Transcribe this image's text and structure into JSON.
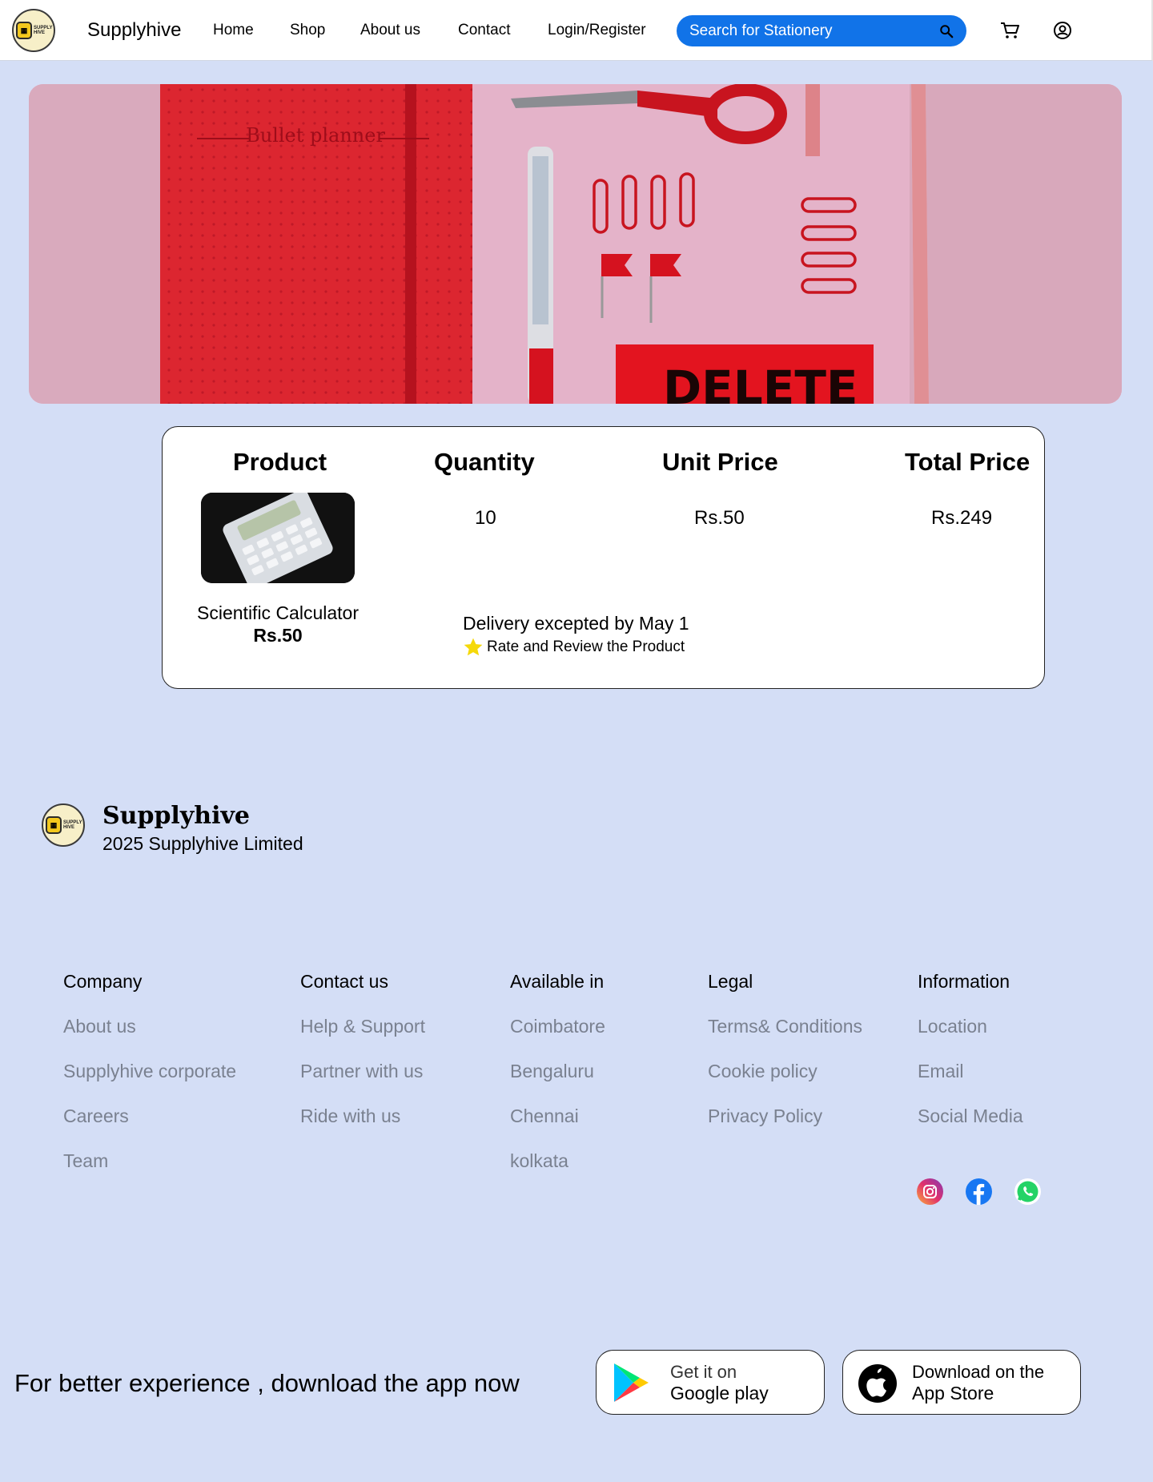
{
  "nav": {
    "brand": "Supplyhive",
    "logo_text": "SUPPLY HIVE",
    "links": [
      "Home",
      "Shop",
      "About us",
      "Contact",
      "Login/Register"
    ],
    "search_placeholder": "Search for Stationery",
    "search_icon": "search-icon",
    "cart_icon": "cart-icon",
    "account_icon": "account-icon"
  },
  "hero": {
    "notebook_label": "Bullet planner",
    "eraser_label": "DELETE"
  },
  "order": {
    "headers": [
      "Product",
      "Quantity",
      "Unit Price",
      "Total Price"
    ],
    "quantity": "10",
    "unit_price": "Rs.50",
    "total_price": "Rs.249",
    "product_name": "Scientific Calculator",
    "product_price": "Rs.50",
    "delivery": "Delivery excepted by May 1",
    "rate_label": "Rate and Review the Product",
    "star_color": "#f5d90a"
  },
  "footer": {
    "brand": "Supplyhive",
    "copyright": "2025 Supplyhive Limited",
    "columns": [
      {
        "title": "Company",
        "items": [
          "About us",
          "Supplyhive corporate",
          "Careers",
          "Team"
        ]
      },
      {
        "title": "Contact us",
        "items": [
          "Help & Support",
          "Partner with us",
          "Ride with us"
        ]
      },
      {
        "title": "Available in",
        "items": [
          "Coimbatore",
          "Bengaluru",
          "Chennai",
          "kolkata"
        ]
      },
      {
        "title": "Legal",
        "items": [
          "Terms& Conditions",
          "Cookie policy",
          "Privacy Policy"
        ]
      },
      {
        "title": "Information",
        "items": [
          "Location",
          "Email",
          "Social Media"
        ]
      }
    ],
    "socials": [
      "instagram-icon",
      "facebook-icon",
      "whatsapp-icon"
    ]
  },
  "app": {
    "cta": "For better experience , download the app now",
    "google": {
      "line1": "Get it on",
      "line2": "Google play"
    },
    "apple": {
      "line1": "Download on the",
      "line2": "App Store"
    }
  },
  "colors": {
    "page_bg": "#d4def6",
    "search_bg": "#1173e8",
    "footer_link": "#7a8190"
  }
}
